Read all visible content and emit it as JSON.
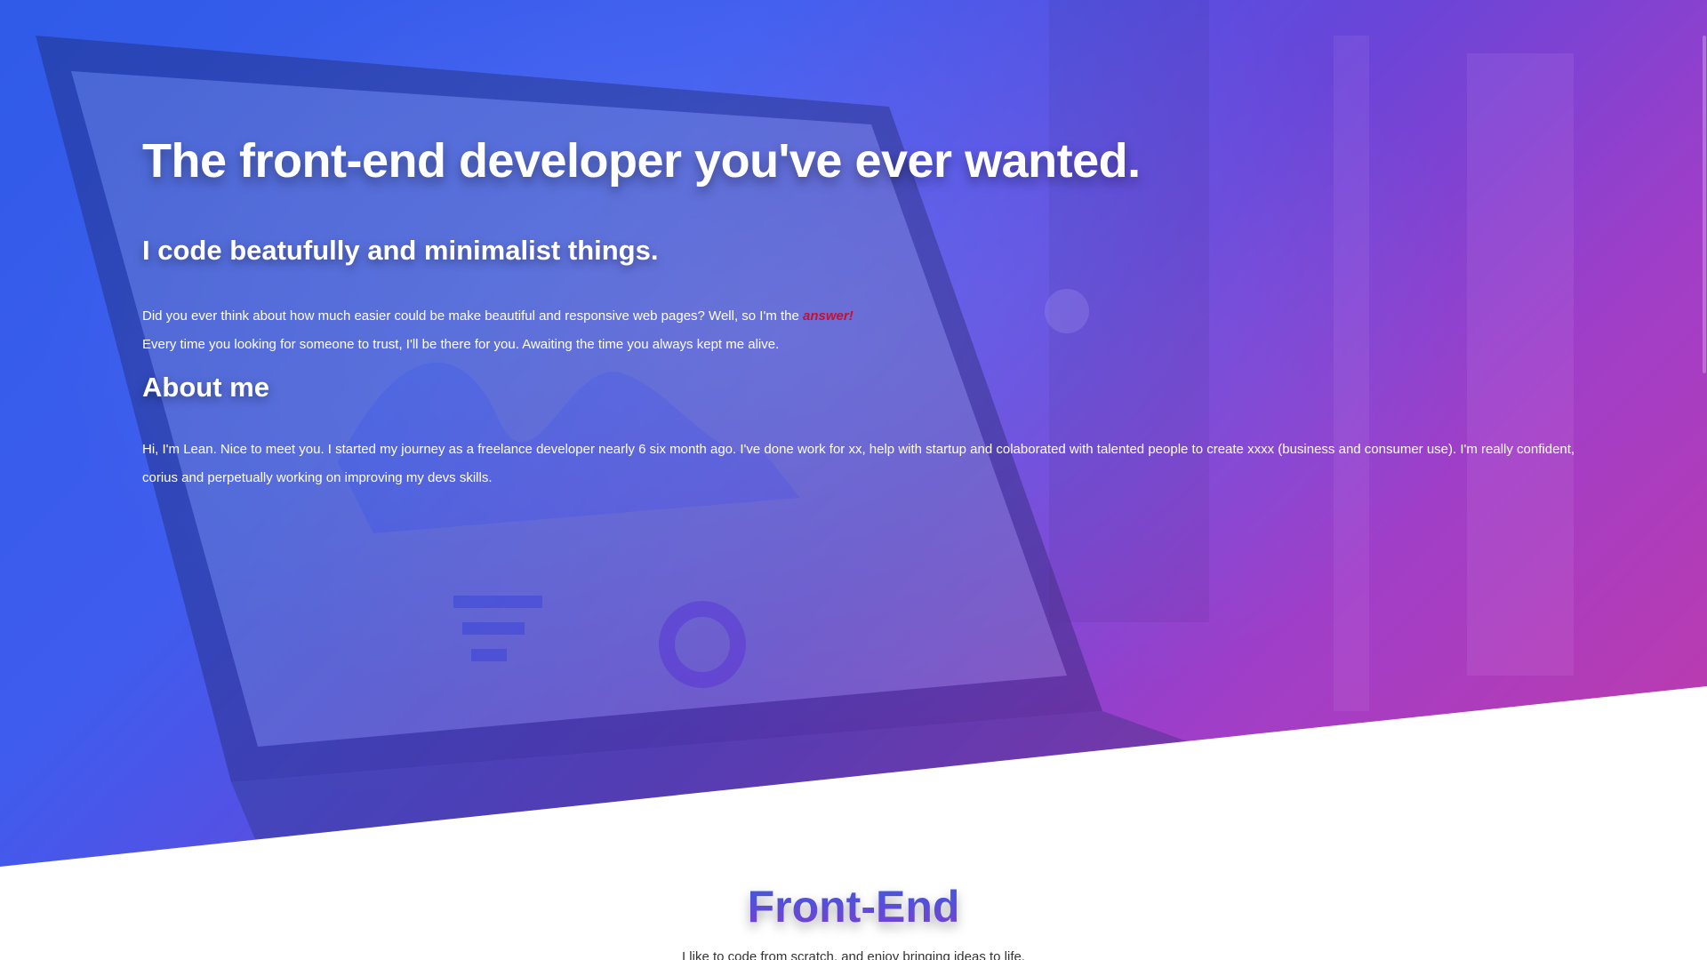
{
  "hero": {
    "title": "The front-end developer you've ever wanted.",
    "subtitle": "I code beatufully and minimalist things.",
    "intro_before": "Did you ever think about how much easier could be make beautiful and responsive web pages? Well, so I'm the ",
    "intro_highlight": "answer!",
    "intro_line2": "Every time you looking for someone to trust, I'll be there for you. Awaiting the time you always kept me alive."
  },
  "about": {
    "title": "About me",
    "text": "Hi, I'm Lean. Nice to meet you. I started my journey as a freelance developer nearly 6 six month ago. I've done work for xx, help with startup and colaborated with talented people to create xxxx (business and consumer use). I'm really confident, corius and perpetually working on improving my devs skills."
  },
  "frontend": {
    "title": "Front-End",
    "text": "I like to code from scratch, and enjoy bringing ideas to life."
  },
  "colors": {
    "gradient_start": "#2f5be8",
    "gradient_end": "#c23aa8",
    "highlight": "#c8102e"
  }
}
